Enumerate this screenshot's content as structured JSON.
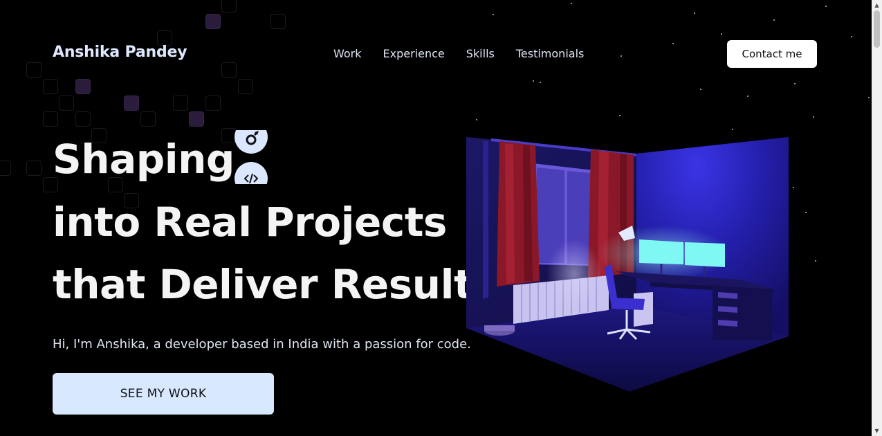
{
  "header": {
    "logo": "Anshika Pandey",
    "nav": [
      "Work",
      "Experience",
      "Skills",
      "Testimonials"
    ],
    "contact_label": "Contact me"
  },
  "hero": {
    "line1": "Shaping",
    "line2": "into Real Projects",
    "line3": "that Deliver Results",
    "slider_icons": [
      "design-icon",
      "code-icon"
    ],
    "intro": "Hi, I'm Anshika, a developer based in India with a passion for code.",
    "cta_label": "SEE MY WORK"
  },
  "colors": {
    "background": "#000000",
    "accent": "#d8e8ff",
    "room_purple": "#2b25a8",
    "monitor_glow": "#7ff8f4"
  }
}
